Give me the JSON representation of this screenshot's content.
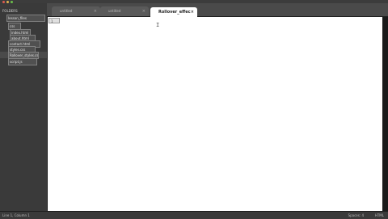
{
  "window": {
    "controls": [
      {
        "name": "close",
        "color": "#e05a4f"
      },
      {
        "name": "minimize",
        "color": "#e0b44f"
      },
      {
        "name": "maximize",
        "color": "#6cc04a"
      }
    ]
  },
  "sidebar": {
    "header": "FOLDERS",
    "items": [
      {
        "label": "lesson_files"
      },
      {
        "label": "css"
      },
      {
        "label": "index.html"
      },
      {
        "label": "about.html"
      },
      {
        "label": "contact.html"
      },
      {
        "label": "styles.css"
      },
      {
        "label": "Rollover_styles.css"
      },
      {
        "label": "script.js"
      }
    ]
  },
  "tabs": [
    {
      "label": "untitled",
      "active": false
    },
    {
      "label": "untitled",
      "active": false
    },
    {
      "label": "Rollover_effec",
      "active": true
    }
  ],
  "editor": {
    "line_number": "1"
  },
  "status": {
    "left": "Line 1, Column 1",
    "spaces": "Spaces: 4",
    "syntax": "HTML"
  }
}
